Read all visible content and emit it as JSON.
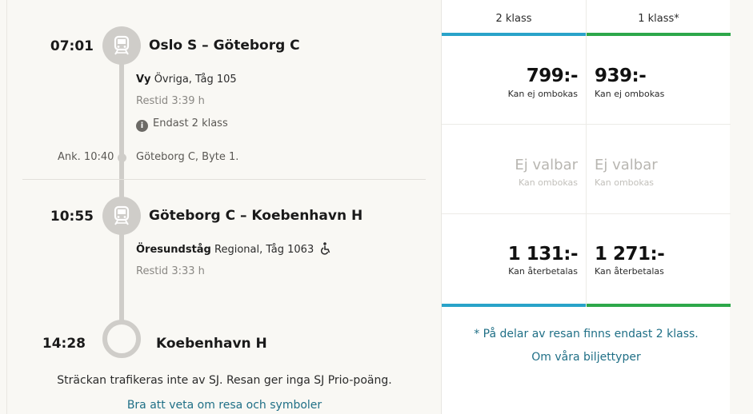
{
  "legs": [
    {
      "departure_time": "07:01",
      "title": "Oslo S – Göteborg C",
      "operator": "Vy",
      "train": "Övriga, Tåg 105",
      "duration": "Restid 3:39 h",
      "info": "Endast 2 klass",
      "arrival_label": "Ank. 10:40",
      "arrival_note": "Göteborg C, Byte 1."
    },
    {
      "departure_time": "10:55",
      "title": "Göteborg C – Koebenhavn H",
      "operator": "Öresundståg",
      "train": "Regional, Tåg 1063",
      "duration": "Restid 3:33 h"
    }
  ],
  "destination": {
    "time": "14:28",
    "name": "Koebenhavn H"
  },
  "footer": {
    "notice": "Sträckan trafikeras inte av SJ. Resan ger inga SJ Prio-poäng.",
    "link": "Bra att veta om resa och symboler"
  },
  "classes": [
    {
      "label": "2 klass",
      "color": "#29a3c9"
    },
    {
      "label": "1 klass*",
      "color": "#2da84a"
    }
  ],
  "fares": [
    {
      "cells": [
        {
          "price": "799:-",
          "sub": "Kan ej ombokas"
        },
        {
          "price": "939:-",
          "sub": "Kan ej ombokas"
        }
      ]
    },
    {
      "cells": [
        {
          "price": "Ej valbar",
          "sub": "Kan ombokas",
          "disabled": true
        },
        {
          "price": "Ej valbar",
          "sub": "Kan ombokas",
          "disabled": true
        }
      ]
    },
    {
      "cells": [
        {
          "price": "1 131:-",
          "sub": "Kan återbetalas"
        },
        {
          "price": "1 271:-",
          "sub": "Kan återbetalas"
        }
      ]
    }
  ],
  "notes": {
    "first_class": "* På delar av resan finns endast 2 klass.",
    "ticket_types": "Om våra biljettyper"
  },
  "icons": {
    "train": "train-icon",
    "info": "info-icon",
    "wheelchair": "wheelchair-icon"
  }
}
